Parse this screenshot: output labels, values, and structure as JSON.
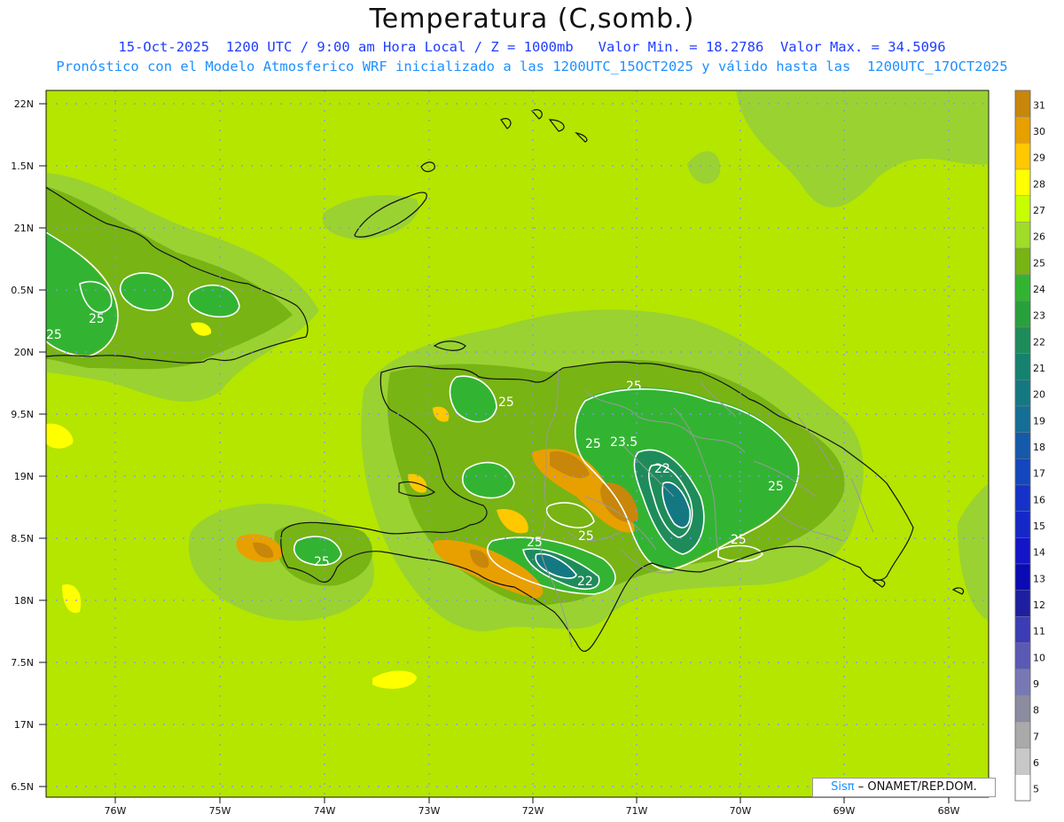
{
  "header": {
    "title": "Temperatura (C,somb.)",
    "line1": "15-Oct-2025  1200 UTC / 9:00 am Hora Local / Z = 1000mb   Valor Min. = 18.2786  Valor Max. = 34.5096",
    "line2": "Pronóstico con el Modelo Atmosferico WRF inicializado a las 1200UTC_15OCT2025 y válido hasta las  1200UTC_17OCT2025"
  },
  "axes": {
    "lat_labels": [
      "22N",
      "1.5N",
      "21N",
      "0.5N",
      "20N",
      "9.5N",
      "19N",
      "8.5N",
      "18N",
      "7.5N",
      "17N",
      "6.5N"
    ],
    "lon_labels": [
      "76W",
      "75W",
      "74W",
      "73W",
      "72W",
      "71W",
      "70W",
      "69W",
      "68W"
    ]
  },
  "colorbar": {
    "labels": [
      "31",
      "30",
      "29",
      "28",
      "27",
      "26",
      "25",
      "24",
      "23",
      "22",
      "21",
      "20",
      "19",
      "18",
      "17",
      "16",
      "15",
      "14",
      "13",
      "12",
      "11",
      "10",
      "9",
      "8",
      "7",
      "6",
      "5"
    ],
    "colors": [
      "#c8860a",
      "#e8a000",
      "#ffc800",
      "#ffff00",
      "#c8ff00",
      "#a0dc28",
      "#78b414",
      "#32b432",
      "#28a03c",
      "#1e8c5a",
      "#14826e",
      "#147882",
      "#146e96",
      "#145aaa",
      "#1446be",
      "#1432c8",
      "#1428c8",
      "#1414c8",
      "#0a0ab4",
      "#1e1ea0",
      "#3c3cb4",
      "#5a5ab4",
      "#7878b4",
      "#8c8ca0",
      "#aaaaaa",
      "#c8c8c8",
      "#ffffff"
    ]
  },
  "contour_labels": [
    "25",
    "25",
    "25",
    "25",
    "25",
    "25",
    "23.5",
    "22",
    "25",
    "25",
    "25",
    "25",
    "22"
  ],
  "credit": {
    "logo": "Sisπ",
    "org": "– ONAMET/REP.DOM."
  },
  "colors": {
    "field_base": "#b4e600",
    "land_outline": "#111111",
    "province_lines": "#999999",
    "grid": "#8c8cff"
  }
}
